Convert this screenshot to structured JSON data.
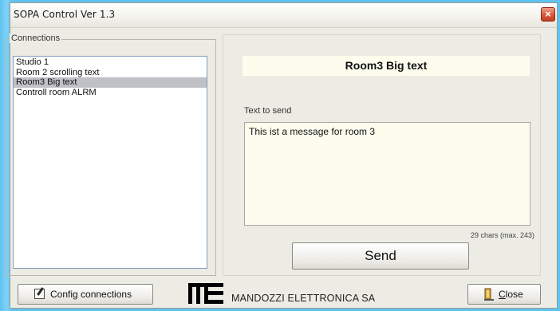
{
  "window": {
    "title": "SOPA Control   Ver 1.3"
  },
  "connections": {
    "group_label": "Connections",
    "items": [
      {
        "label": "Studio 1",
        "selected": false
      },
      {
        "label": "Room 2 scrolling text",
        "selected": false
      },
      {
        "label": "Room3 Big text",
        "selected": true
      },
      {
        "label": "Controll room ALRM",
        "selected": false
      }
    ]
  },
  "detail": {
    "room_title": "Room3 Big text",
    "text_to_send_label": "Text to send",
    "message": "This ist a message for room 3",
    "char_count": "29 chars (max. 243)",
    "send_label": "Send"
  },
  "footer": {
    "config_label": "Config connections",
    "company": "MANDOZZI ELETTRONICA SA",
    "logo_text": "ME",
    "close_first": "C",
    "close_rest": "lose"
  },
  "icons": {
    "window_close": "close-icon",
    "config": "config-edit-icon",
    "close_button": "door-exit-icon"
  },
  "colors": {
    "window_bg": "#ecebe4",
    "selected_item": "#c0c0c7",
    "text_area_bg": "#fdfdee",
    "desktop_bg": "#5ec3f0",
    "close_x": "#d9573a"
  }
}
